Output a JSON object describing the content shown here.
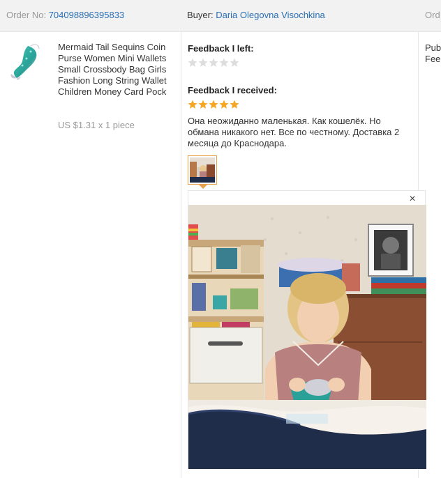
{
  "order": {
    "number_label": "Order No:",
    "number_value": "704098896395833",
    "buyer_label": "Buyer:",
    "buyer_name": "Daria Olegovna Visochkina",
    "cut_label": "Ord"
  },
  "product": {
    "title": "Mermaid Tail Sequins Coin Purse Women Mini Wallets Small Crossbody Bag Girls Fashion Long String Wallet Children Money Card Pock",
    "price": "US $1.31 x 1 piece",
    "thumbnail_icon": "mermaid-purse-image"
  },
  "feedback": {
    "left_title": "Feedback I left:",
    "left_rating": 0,
    "received_title": "Feedback I received:",
    "received_rating": 5,
    "received_text": "Она неожиданно маленькая. Как кошелёк. Но обмана никакого нет. Все по честному. Доставка 2 месяца до Краснодара.",
    "max_rating": 5
  },
  "preview": {
    "close_glyph": "×"
  },
  "right_column": {
    "line1": "Pub",
    "line2": "Fee"
  },
  "colors": {
    "link": "#2a6fb5",
    "star_on": "#f5a623",
    "star_off": "#dddddd",
    "accent_border": "#e9a24c",
    "header_bg": "#f2f2f2"
  }
}
